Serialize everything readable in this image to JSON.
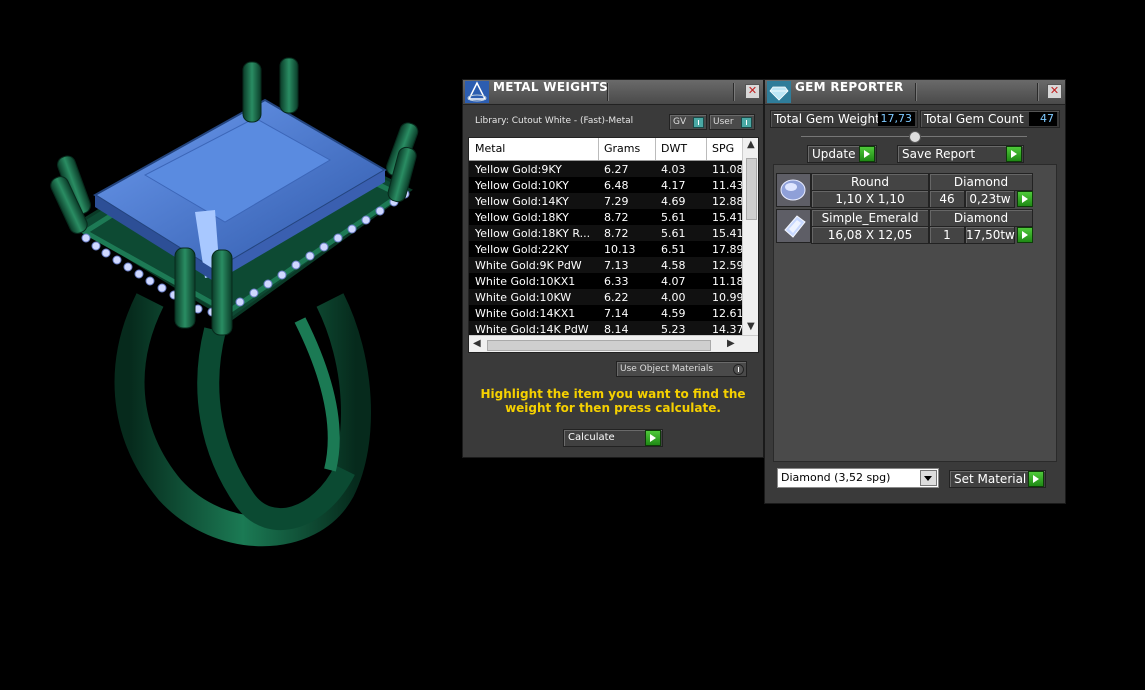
{
  "metal_weights": {
    "title": "METAL WEIGHTS",
    "library_label": "Library: Cutout White - (Fast)-Metal",
    "gv_label": "GV",
    "user_label": "User",
    "columns": [
      "Metal",
      "Grams",
      "DWT",
      "SPG"
    ],
    "rows": [
      [
        "Yellow Gold:9KY",
        "6.27",
        "4.03",
        "11.08"
      ],
      [
        "Yellow Gold:10KY",
        "6.48",
        "4.17",
        "11.43"
      ],
      [
        "Yellow Gold:14KY",
        "7.29",
        "4.69",
        "12.88"
      ],
      [
        "Yellow Gold:18KY",
        "8.72",
        "5.61",
        "15.41"
      ],
      [
        "Yellow Gold:18KY R...",
        "8.72",
        "5.61",
        "15.41"
      ],
      [
        "Yellow Gold:22KY",
        "10.13",
        "6.51",
        "17.89"
      ],
      [
        "White Gold:9K PdW",
        "7.13",
        "4.58",
        "12.59"
      ],
      [
        "White Gold:10KX1",
        "6.33",
        "4.07",
        "11.18"
      ],
      [
        "White Gold:10KW",
        "6.22",
        "4.00",
        "10.99"
      ],
      [
        "White Gold:14KX1",
        "7.14",
        "4.59",
        "12.61"
      ],
      [
        "White Gold:14K PdW",
        "8.14",
        "5.23",
        "14.37"
      ]
    ],
    "use_object_materials": "Use Object Materials",
    "hint": "Highlight the item you want to find the weight for then press calculate.",
    "calculate_label": "Calculate"
  },
  "gem_reporter": {
    "title": "GEM REPORTER",
    "total_weight_label": "Total Gem Weight",
    "total_weight_value": "17,73",
    "total_count_label": "Total Gem Count",
    "total_count_value": "47",
    "update_label": "Update",
    "save_report_label": "Save Report",
    "gems": [
      {
        "shape": "Round",
        "material": "Diamond",
        "size": "1,10 X 1,10",
        "count": "46",
        "weight": "0,23tw"
      },
      {
        "shape": "Simple_Emerald",
        "material": "Diamond",
        "size": "16,08 X 12,05",
        "count": "1",
        "weight": "17,50tw"
      }
    ],
    "material_select": "Diamond    (3,52 spg)",
    "set_material_label": "Set Material"
  },
  "colors": {
    "background": "#000000",
    "panel": "#3a3a3a",
    "ring_green": "#0f5a3c",
    "gem_blue": "#4d7fd8",
    "hint_yellow": "#f5d000",
    "value_blue": "#7ec9ff"
  }
}
